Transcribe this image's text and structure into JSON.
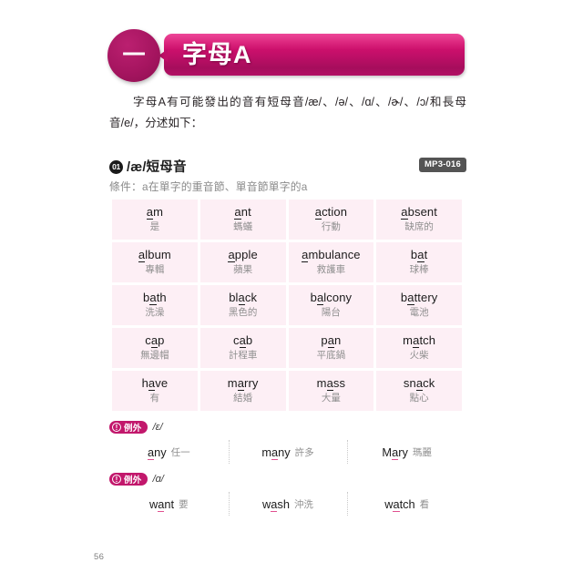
{
  "chapter": {
    "number_label": "一",
    "title": "字母A"
  },
  "intro": {
    "text": "字母A有可能發出的音有短母音/æ/、/ə/、/ɑ/、/ɚ/、/ɔ/和長母音/e/，分述如下："
  },
  "section": {
    "number": "01",
    "title": "/æ/短母音",
    "audio_badge": "MP3-016",
    "condition": "條件：a在單字的重音節、單音節單字的a"
  },
  "word_table": {
    "rows": [
      [
        {
          "pre": "",
          "mark": "a",
          "post": "m",
          "zh": "是"
        },
        {
          "pre": "",
          "mark": "a",
          "post": "nt",
          "zh": "螞蟻"
        },
        {
          "pre": "",
          "mark": "a",
          "post": "ction",
          "zh": "行動"
        },
        {
          "pre": "",
          "mark": "a",
          "post": "bsent",
          "zh": "缺席的"
        }
      ],
      [
        {
          "pre": "",
          "mark": "a",
          "post": "lbum",
          "zh": "專輯"
        },
        {
          "pre": "",
          "mark": "a",
          "post": "pple",
          "zh": "蘋果"
        },
        {
          "pre": "",
          "mark": "a",
          "post": "mbulance",
          "zh": "救護車"
        },
        {
          "pre": "b",
          "mark": "a",
          "post": "t",
          "zh": "球棒"
        }
      ],
      [
        {
          "pre": "b",
          "mark": "a",
          "post": "th",
          "zh": "洗澡"
        },
        {
          "pre": "bl",
          "mark": "a",
          "post": "ck",
          "zh": "黑色的"
        },
        {
          "pre": "b",
          "mark": "a",
          "post": "lcony",
          "zh": "陽台"
        },
        {
          "pre": "b",
          "mark": "a",
          "post": "ttery",
          "zh": "電池"
        }
      ],
      [
        {
          "pre": "c",
          "mark": "a",
          "post": "p",
          "zh": "無邊帽"
        },
        {
          "pre": "c",
          "mark": "a",
          "post": "b",
          "zh": "計程車"
        },
        {
          "pre": "p",
          "mark": "a",
          "post": "n",
          "zh": "平底鍋"
        },
        {
          "pre": "m",
          "mark": "a",
          "post": "tch",
          "zh": "火柴"
        }
      ],
      [
        {
          "pre": "h",
          "mark": "a",
          "post": "ve",
          "zh": "有"
        },
        {
          "pre": "m",
          "mark": "a",
          "post": "rry",
          "zh": "結婚"
        },
        {
          "pre": "m",
          "mark": "a",
          "post": "ss",
          "zh": "大量"
        },
        {
          "pre": "sn",
          "mark": "a",
          "post": "ck",
          "zh": "點心"
        }
      ]
    ]
  },
  "exceptions": [
    {
      "badge_icon": "!",
      "badge_label": "例外",
      "phoneme": "/ɛ/",
      "words": [
        {
          "pre": "",
          "mark": "a",
          "post": "ny",
          "zh": "任一"
        },
        {
          "pre": "m",
          "mark": "a",
          "post": "ny",
          "zh": "許多"
        },
        {
          "pre": "M",
          "mark": "a",
          "post": "ry",
          "zh": "瑪麗"
        }
      ]
    },
    {
      "badge_icon": "!",
      "badge_label": "例外",
      "phoneme": "/ɑ/",
      "words": [
        {
          "pre": "w",
          "mark": "a",
          "post": "nt",
          "zh": "要"
        },
        {
          "pre": "w",
          "mark": "a",
          "post": "sh",
          "zh": "沖洗"
        },
        {
          "pre": "w",
          "mark": "a",
          "post": "tch",
          "zh": "看"
        }
      ]
    }
  ],
  "footer": {
    "page_number": "56"
  },
  "colors": {
    "banner_pink": "#e8197e",
    "banner_dark": "#a60d5c",
    "circle_crimson": "#a61560",
    "cell_bg": "#fdeff5",
    "badge_gray": "#545454",
    "exception_pill": "#c2186c",
    "underline_pink": "#e0508f"
  }
}
